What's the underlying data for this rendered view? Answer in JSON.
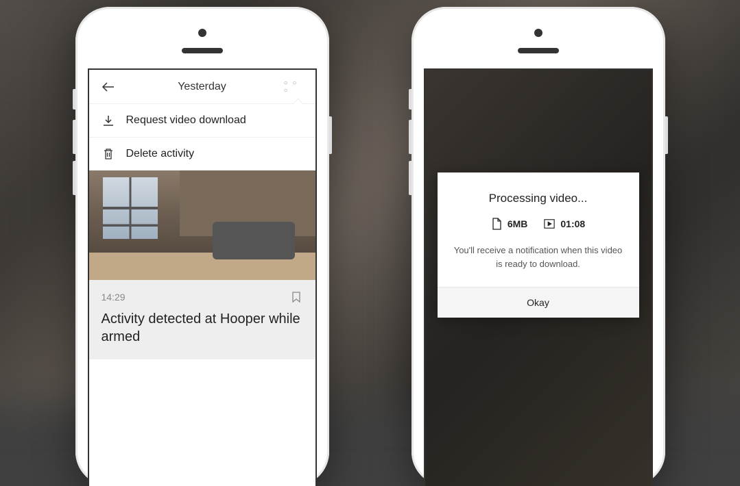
{
  "phone1": {
    "header": {
      "title": "Yesterday"
    },
    "dropdown": {
      "items": [
        {
          "label": "Request video download",
          "icon": "download-icon"
        },
        {
          "label": "Delete activity",
          "icon": "trash-icon"
        }
      ]
    },
    "activity": {
      "time": "14:29",
      "title": "Activity detected at Hooper while armed"
    }
  },
  "phone2": {
    "modal": {
      "title": "Processing video...",
      "file_size": "6MB",
      "duration": "01:08",
      "message": "You'll receive a notification when this video is ready to download.",
      "confirm_label": "Okay"
    }
  }
}
